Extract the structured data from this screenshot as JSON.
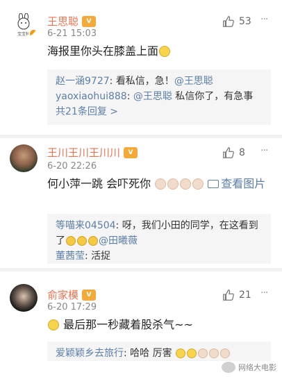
{
  "comments": [
    {
      "name": "王思聪",
      "time": "6-21 15:03",
      "likes": "53",
      "avatar_caption": "宝宝科",
      "text": "海报里你头在膝盖上面",
      "replies": [
        {
          "name": "赵一涵9727",
          "sep": ": ",
          "text": "看私信，急！",
          "at": "@王思聪"
        },
        {
          "name": "yaoxiaohui888",
          "sep": ": ",
          "at": "@王思聪",
          "text": " 私信你了，有急事"
        }
      ],
      "total_replies": "共21条回复 >"
    },
    {
      "name": "王川王川王川川",
      "time": "6-20 22:26",
      "likes": "8",
      "text": "何小萍一跳 会吓死你",
      "see_image": "查看图片",
      "replies": [
        {
          "name": "等喵来04504",
          "sep": ": ",
          "text": "呀，我们小田的同学，在这看到了",
          "at": "@田曦薇"
        },
        {
          "name": "董茜莹",
          "sep": ": ",
          "text": "活捉"
        }
      ]
    },
    {
      "name": "俞家模",
      "time": "6-20 17:29",
      "likes": "21",
      "text": "最后那一秒藏着股杀气~~",
      "replies": [
        {
          "name": "爱颖颖乡去旅行",
          "sep": ": ",
          "text": "哈哈 厉害"
        }
      ]
    }
  ],
  "more_label": "···",
  "vip_label": "V",
  "watermark": "网络大电影"
}
